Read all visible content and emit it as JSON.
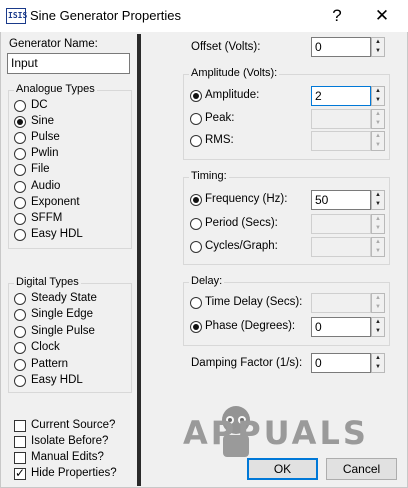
{
  "window": {
    "title": "Sine Generator Properties",
    "help_glyph": "?",
    "close_glyph": "✕",
    "icon_text": "ISIS"
  },
  "left": {
    "generator_name_label": "Generator Name:",
    "generator_name_value": "Input",
    "analogue": {
      "title": "Analogue Types",
      "items": [
        "DC",
        "Sine",
        "Pulse",
        "Pwlin",
        "File",
        "Audio",
        "Exponent",
        "SFFM",
        "Easy HDL"
      ],
      "selected": "Sine"
    },
    "digital": {
      "title": "Digital Types",
      "items": [
        "Steady State",
        "Single Edge",
        "Single Pulse",
        "Clock",
        "Pattern",
        "Easy HDL"
      ]
    },
    "checks": [
      {
        "label": "Current Source?",
        "checked": false
      },
      {
        "label": "Isolate Before?",
        "checked": false
      },
      {
        "label": "Manual Edits?",
        "checked": false
      },
      {
        "label": "Hide Properties?",
        "checked": true
      }
    ]
  },
  "right": {
    "offset": {
      "label": "Offset (Volts):",
      "value": "0"
    },
    "amplitude": {
      "title": "Amplitude (Volts):",
      "rows": [
        {
          "label": "Amplitude:",
          "value": "2",
          "selected": true
        },
        {
          "label": "Peak:",
          "value": "",
          "selected": false
        },
        {
          "label": "RMS:",
          "value": "",
          "selected": false
        }
      ]
    },
    "timing": {
      "title": "Timing:",
      "rows": [
        {
          "label": "Frequency (Hz):",
          "value": "50",
          "selected": true
        },
        {
          "label": "Period (Secs):",
          "value": "",
          "selected": false
        },
        {
          "label": "Cycles/Graph:",
          "value": "",
          "selected": false
        }
      ]
    },
    "delay": {
      "title": "Delay:",
      "rows": [
        {
          "label": "Time Delay (Secs):",
          "value": "",
          "selected": false
        },
        {
          "label": "Phase (Degrees):",
          "value": "0",
          "selected": true
        }
      ]
    },
    "damping": {
      "label": "Damping Factor (1/s):",
      "value": "0"
    }
  },
  "buttons": {
    "ok": "OK",
    "cancel": "Cancel"
  },
  "watermark": "APPUALS"
}
